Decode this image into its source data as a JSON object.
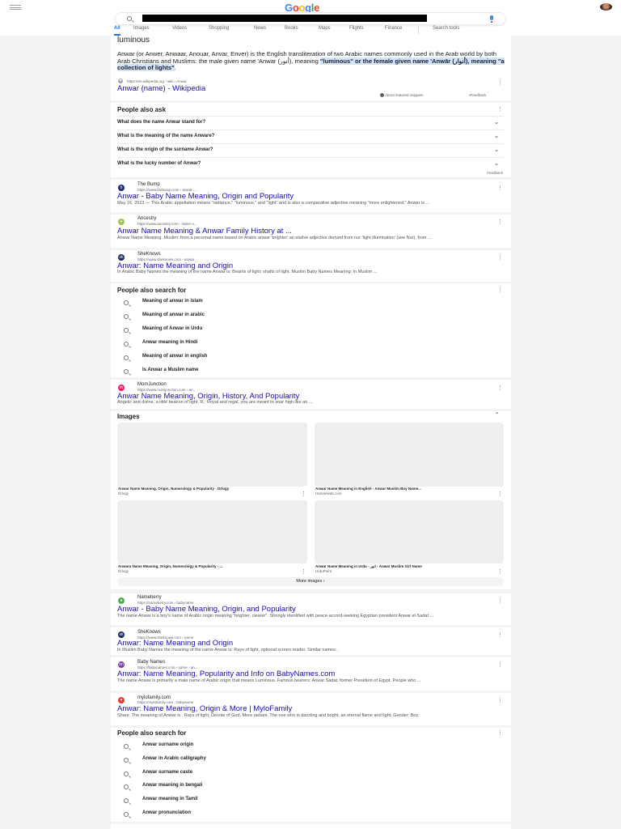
{
  "header": {
    "logo": "Google",
    "tabs": [
      "All",
      "Images",
      "Videos",
      "Shopping",
      "News",
      "Books",
      "Maps",
      "Flights",
      "Finance"
    ],
    "tools": "Search tools"
  },
  "snippet": {
    "heading": "luminous",
    "text_a": "Anwar (or Anwer, Anwaar, Anouar, Anvar, Enver) is the English transliteration of two Arabic names commonly used in the Arab world by both Arab Christians and Muslims: the male given name 'Anwar (أنور), meaning ",
    "hl1": "\"luminous\" or the female given name 'Anwār (أنوار), meaning \"a collection of lights\"",
    "text_b": ".",
    "url": "https://en.wikipedia.org › wiki › Anwar",
    "title": "Anwar (name) - Wikipedia",
    "about": "About featured snippets",
    "feedback": "Feedback"
  },
  "paa": {
    "heading": "People also ask",
    "questions": [
      "What does the name Anwar stand for?",
      "What is the meaning of the name Anware?",
      "What is the origin of the surname Anwar?",
      "What is the lucky number of Anwar?"
    ],
    "feedback": "Feedback"
  },
  "results1": [
    {
      "source": "The Bump",
      "url": "https://www.thebump.com › anwar-...",
      "title": "Anwar - Baby Name Meaning, Origin and Popularity",
      "snippet": "May 16, 2023 — This Arabic appellation means \"radiance,\" \"luminous,\" and \"light\" and is also a comparative adjective meaning \"more enlightened.\" Anwar is ..."
    },
    {
      "source": "Ancestry",
      "url": "https://www.ancestry.com › name-o...",
      "title": "Anwar Name Meaning & Anwar Family History at ...",
      "snippet": "Anwar Name Meaning. Muslim: from a personal name based on Arabic anwar 'brighter' an elative adjective derived from nur 'light illumination' (see Nur), from ..."
    },
    {
      "source": "SheKnows",
      "url": "https://www.sheknows.com › anwar",
      "title": "Anwar: Name Meaning and Origin",
      "snippet": "In Arabic Baby Names the meaning of the name Anwar is: Beams of light; shafts of light. Muslim Baby Names Meaning: In Muslim ..."
    }
  ],
  "pas1": {
    "heading": "People also search for",
    "items": [
      "Meaning of anwar in islam",
      "Meaning of anwar in arabic",
      "Meaning of Anwar in Urdu",
      "Anwar meaning in Hindi",
      "Meaning of anwar in english",
      "Is Anwar a Muslim name"
    ]
  },
  "mom": {
    "source": "MomJunction",
    "url": "https://www.momjunction.com › an...",
    "title": "Anwar Name Meaning, Origin, History, And Popularity",
    "snippet": "Angelic and divine, a little beacon of light. R.: Royal and regal, you are meant to soar high like an ..."
  },
  "images": {
    "heading": "Images",
    "items": [
      {
        "caption": "Anwar Name Meaning, Origin, Numerology & Popularity - Drlogy",
        "source": "Drlogy"
      },
      {
        "caption": "Anwar Name Meaning in English - Anwar Muslim Boy Name...",
        "source": "Hamariweb.com"
      },
      {
        "caption": "Anwara Name Meaning, Origin, Numerology & Popularity - ...",
        "source": "Drlogy"
      },
      {
        "caption": "Anwar Name Meaning in Urdu - انور - Anwar Muslim Girl Name",
        "source": "UrduPoint"
      }
    ],
    "more": "More images"
  },
  "results2": [
    {
      "source": "Nameberry",
      "url": "https://nameberry.com › babyname",
      "title": "Anwar - Baby Name Meaning, Origin, and Popularity",
      "snippet": "The name Anwar is a boy's name of Arabic origin meaning \"brighter, clearer\". Strongly identified with peace-accord-seeking Egyptian president Anwar el-Sadat ..."
    },
    {
      "source": "SheKnows",
      "url": "https://www.sheknows.com › name",
      "title": "Anwar: Name Meaning and Origin",
      "snippet": "In Muslim Baby Names the meaning of the name Anwar is: Rays of light, optional screen reader. Similar names:."
    },
    {
      "source": "Baby Names",
      "url": "https://babynames.com › name › an...",
      "title": "Anwar: Name Meaning, Popularity and Info on BabyNames.com",
      "snippet": "The name Anwar is primarily a male name of Arabic origin that means Luminous. Famous bearers: Anwar Sadat, former President of Egypt. People who ..."
    },
    {
      "source": "mylofamily.com",
      "url": "https://mylofamily.com › babyname",
      "title": "Anwar: Name Meaning, Origin & More | MyloFamily",
      "snippet": "Share. The meaning of Anwar is : Rays of light, Devote of God, More radiant, The one who is dazzling and bright, an eternal flame and light. Gender: Boy."
    }
  ],
  "pas2": {
    "heading": "People also search for",
    "items": [
      "Anwar surname origin",
      "Anwar in Arabic calligraphy",
      "Anwar surname caste",
      "Anwar meaning in bengali",
      "Anwar meaning in Tamil",
      "Anwar pronunciation"
    ]
  },
  "colors": {
    "link": "#1a0dab",
    "accent": "#1a73e8",
    "highlight": "#d3e3fd"
  }
}
